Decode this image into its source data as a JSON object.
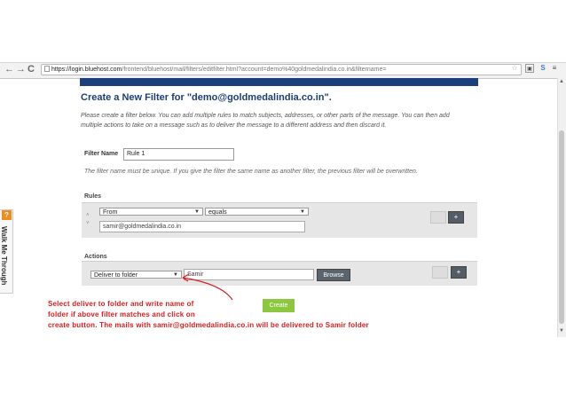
{
  "browser": {
    "back": "←",
    "forward": "→",
    "reload": "C",
    "url_host": "https://login.bluehost.com",
    "url_rest": "/frontend/bluehost/mail/filters/editfilter.html?account=demo%40goldmedalindia.co.in&filtername="
  },
  "page": {
    "title": "Create a New Filter for \"demo@goldmedalindia.co.in\".",
    "intro": "Please create a filter below. You can add multiple rules to match subjects, addresses, or other parts of the message. You can then add multiple actions to take on a message such as to deliver the message to a different address and then discard it.",
    "filter_name_label": "Filter Name",
    "filter_name_value": "Rule 1",
    "filter_name_help": "The filter name must be unique. If you give the filter the same name as another filter, the previous filter will be overwritten."
  },
  "rules": {
    "label": "Rules",
    "field": "From",
    "operator": "equals",
    "value": "samir@goldmedalindia.co.in",
    "add_label": "+"
  },
  "actions": {
    "label": "Actions",
    "action": "Deliver to folder",
    "folder_value": "Samir",
    "browse_label": "Browse",
    "add_label": "+"
  },
  "create_label": "Create",
  "annotation": [
    "Select deliver to folder and write name of",
    "folder if above filter matches and click on",
    "create button. The mails with samir@goldmedalindia.co.in will be delivered to Samir folder"
  ],
  "walkme": {
    "icon": "?",
    "label": "Walk Me Through"
  },
  "colors": {
    "accent_blue": "#1d3e72",
    "create_green": "#8dc63f",
    "annotation_red": "#e01b1b",
    "walkme_orange": "#f08c1e"
  }
}
